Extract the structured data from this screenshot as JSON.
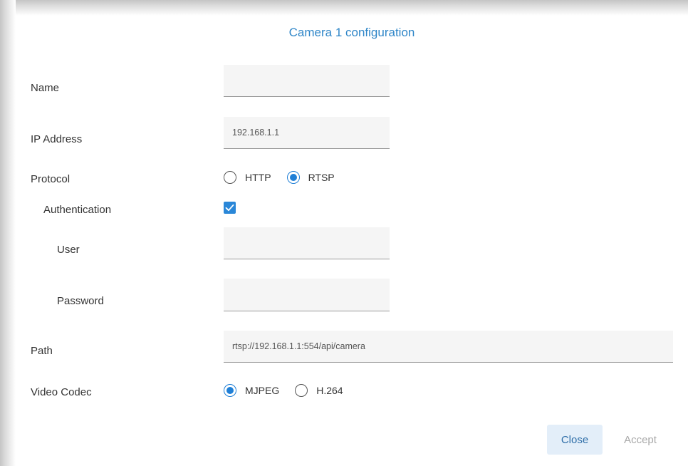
{
  "dialog": {
    "title": "Camera 1 configuration"
  },
  "form": {
    "name_label": "Name",
    "name_value": "",
    "ip_label": "IP Address",
    "ip_value": "192.168.1.1",
    "protocol_label": "Protocol",
    "protocol_options": [
      "HTTP",
      "RTSP"
    ],
    "protocol_selected": "RTSP",
    "auth_label": "Authentication",
    "auth_checked": true,
    "user_label": "User",
    "user_value": "",
    "password_label": "Password",
    "password_value": "",
    "path_label": "Path",
    "path_value": "rtsp://192.168.1.1:554/api/camera",
    "codec_label": "Video Codec",
    "codec_options": [
      "MJPEG",
      "H.264"
    ],
    "codec_selected": "MJPEG"
  },
  "buttons": {
    "close_label": "Close",
    "accept_label": "Accept"
  },
  "colors": {
    "accent": "#1f7fd6",
    "title": "#2f86c8",
    "disabled_text": "#a9a9a9"
  }
}
